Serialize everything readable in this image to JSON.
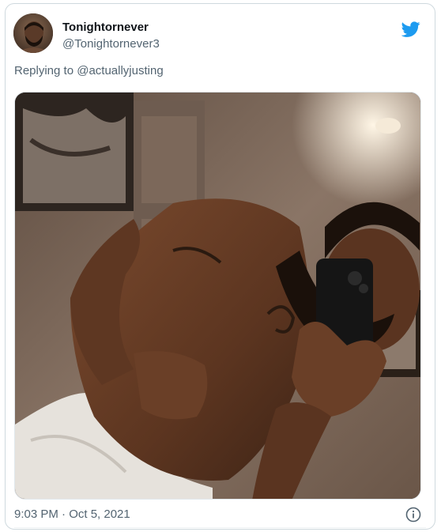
{
  "tweet": {
    "display_name": "Tonightornever",
    "handle": "@Tonightornever3",
    "reply_prefix": "Replying to",
    "reply_mention": "@actuallyjusting",
    "timestamp": "9:03 PM · Oct 5, 2021"
  },
  "icons": {
    "brand": "twitter-bird-icon",
    "info": "info-icon"
  },
  "colors": {
    "brand": "#1d9bf0",
    "text_secondary": "#536471",
    "text_primary": "#0f1419",
    "border": "#cfd9de"
  }
}
